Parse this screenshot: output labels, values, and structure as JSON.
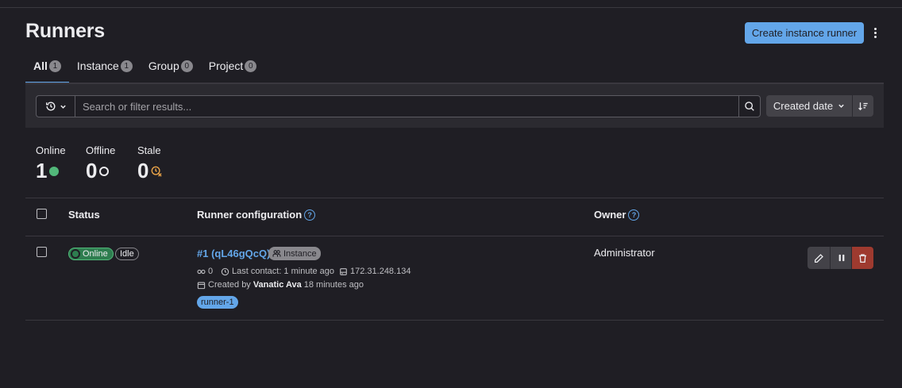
{
  "header": {
    "title": "Runners",
    "create_button": "Create instance runner",
    "more_icon": "kebab-vertical-icon"
  },
  "tabs": [
    {
      "label": "All",
      "count": "1",
      "active": true
    },
    {
      "label": "Instance",
      "count": "1"
    },
    {
      "label": "Group",
      "count": "0"
    },
    {
      "label": "Project",
      "count": "0"
    }
  ],
  "filter": {
    "history_icon": "history-icon",
    "search_placeholder": "Search or filter results...",
    "search_value": "",
    "sort_label": "Created date",
    "sort_direction_icon": "sort-descending-icon"
  },
  "stats": {
    "online": {
      "label": "Online",
      "value": "1"
    },
    "offline": {
      "label": "Offline",
      "value": "0"
    },
    "stale": {
      "label": "Stale",
      "value": "0"
    }
  },
  "table": {
    "headers": {
      "status": "Status",
      "config": "Runner configuration",
      "owner": "Owner"
    },
    "rows": [
      {
        "status": "Online",
        "idle": "Idle",
        "name": "#1 (qL46gQcQ)",
        "type": "Instance",
        "jobs": "0",
        "last_contact": "Last contact: 1 minute ago",
        "ip": "172.31.248.134",
        "created_prefix": "Created by",
        "created_by": "Vanatic Ava",
        "created_ago": "18 minutes ago",
        "tag": "runner-1",
        "owner": "Administrator"
      }
    ]
  },
  "colors": {
    "background": "#1f1e24",
    "accent": "#63a6e9",
    "online": "#52b87a",
    "stale": "#e9a348",
    "danger": "#9e3a2f"
  }
}
